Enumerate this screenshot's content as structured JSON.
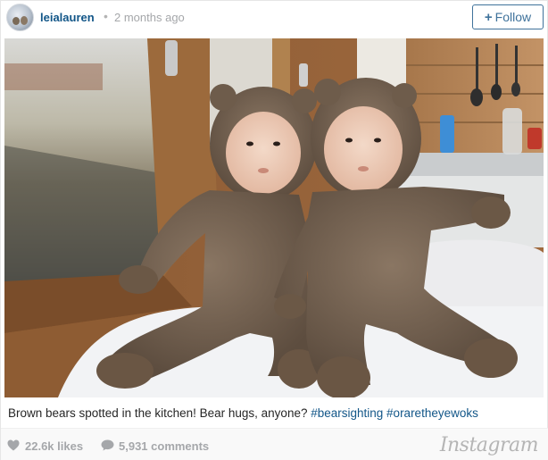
{
  "header": {
    "username": "leialauren",
    "separator": "•",
    "time_ago": "2 months ago",
    "follow_label": "Follow",
    "follow_icon": "plus-icon"
  },
  "photo": {
    "subject": "two-babies-in-bear-costumes"
  },
  "caption": {
    "text": "Brown bears spotted in the kitchen! Bear hugs, anyone? ",
    "hashtags": [
      "#bearsighting",
      "#oraretheyewoks"
    ]
  },
  "footer": {
    "likes": "22.6k likes",
    "comments": "5,931 comments",
    "brand": "Instagram",
    "like_icon": "heart-icon",
    "comment_icon": "speech-bubble-icon"
  },
  "colors": {
    "link": "#125688",
    "follow_border": "#3f729b",
    "muted": "#a5a7aa"
  }
}
